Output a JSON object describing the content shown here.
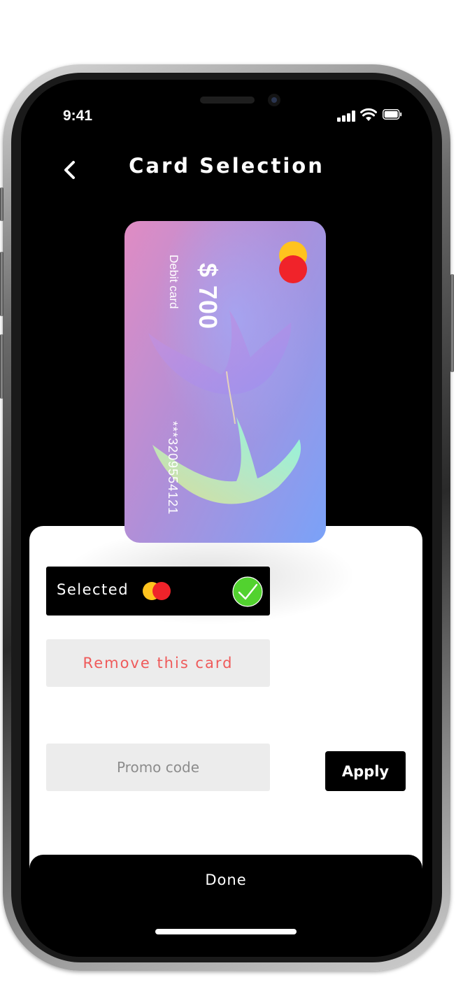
{
  "status_bar": {
    "time": "9:41"
  },
  "header": {
    "title": "Card Selection"
  },
  "card": {
    "balance": "$ 700",
    "type": "Debit card",
    "number": "***3209554121",
    "gradient": [
      "#e08cc3",
      "#b08fd8",
      "#7aa2f8"
    ],
    "logo_colors": [
      "#ffc31e",
      "#f0232a"
    ]
  },
  "selection": {
    "label": "Selected",
    "check_color": "#52d22f"
  },
  "actions": {
    "remove_label": "Remove this card"
  },
  "promo": {
    "placeholder": "Promo code",
    "value": "",
    "apply_label": "Apply"
  },
  "footer": {
    "done_label": "Done"
  },
  "colors": {
    "danger": "#ef5a5a",
    "field_bg": "#ececec",
    "screen_bg": "#000000"
  }
}
